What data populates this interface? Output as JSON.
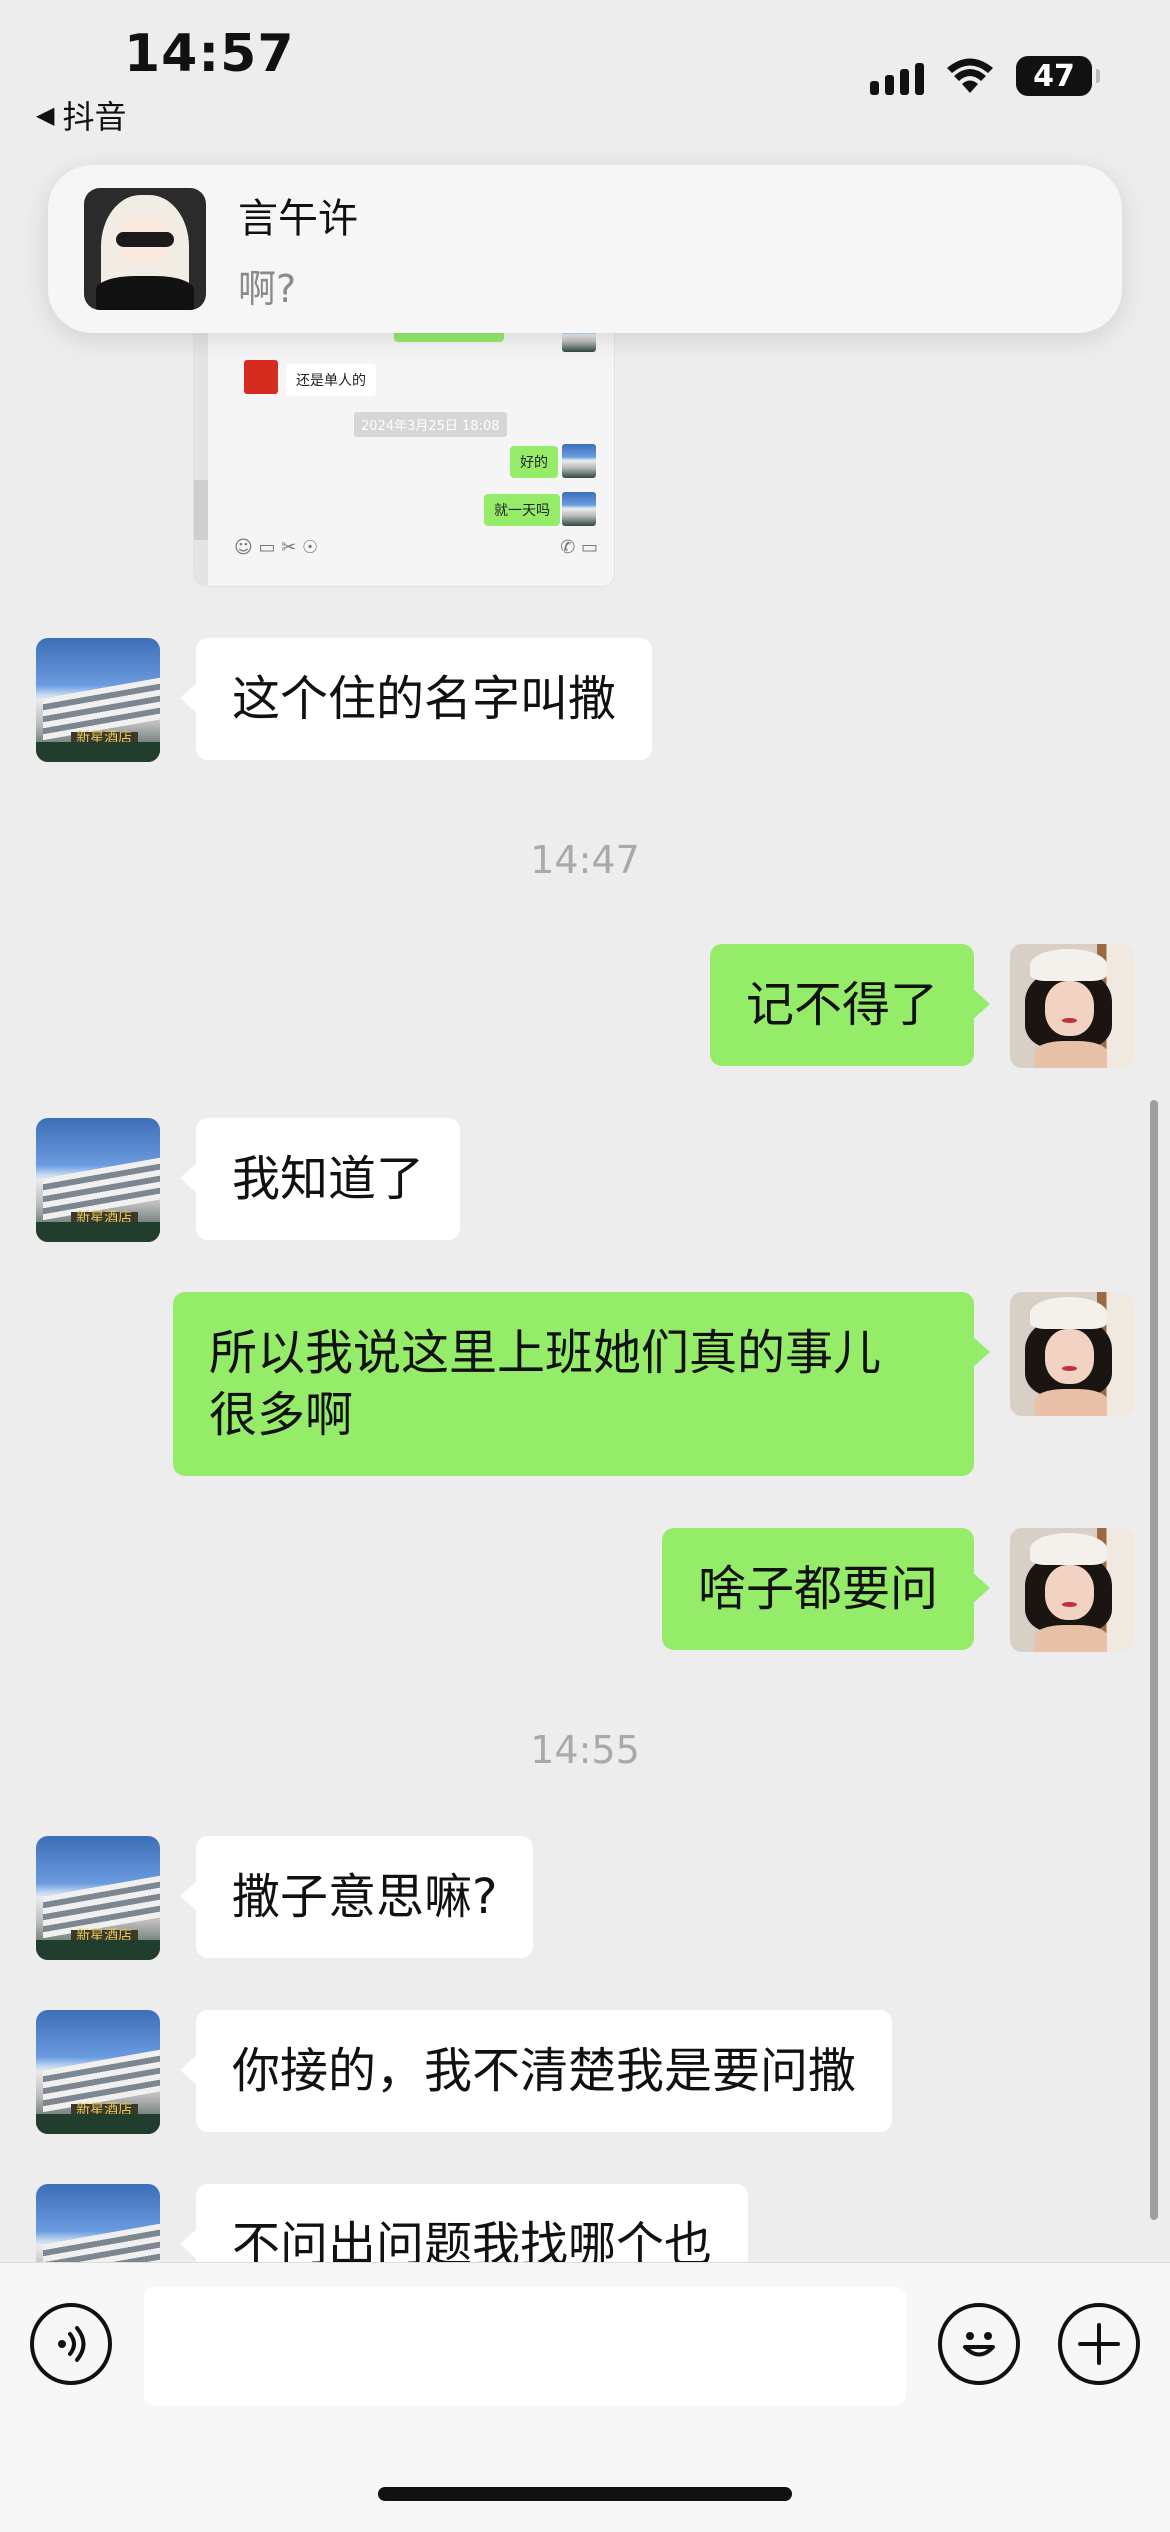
{
  "status_bar": {
    "time": "14:57",
    "back_app": "抖音",
    "battery": "47"
  },
  "notification": {
    "sender": "言午许",
    "message": "啊?"
  },
  "shared_screenshot": {
    "bubbles": [
      "还是单人的",
      "好的",
      "就一天吗"
    ],
    "timestamp": "2024年3月25日 18:08"
  },
  "messages": [
    {
      "side": "left",
      "text": "这个住的名字叫撒"
    },
    {
      "side": "time",
      "text": "14:47"
    },
    {
      "side": "right",
      "text": "记不得了"
    },
    {
      "side": "left",
      "text": "我知道了"
    },
    {
      "side": "right",
      "text": "所以我说这里上班她们真的事儿\n很多啊"
    },
    {
      "side": "right",
      "text": "啥子都要问"
    },
    {
      "side": "time",
      "text": "14:55"
    },
    {
      "side": "left",
      "text": "撒子意思嘛?"
    },
    {
      "side": "left",
      "text": "你接的，我不清楚我是要问撒"
    },
    {
      "side": "left",
      "text": "不问出问题我找哪个也"
    }
  ],
  "input": {
    "value": "",
    "placeholder": ""
  },
  "colors": {
    "background": "#ededed",
    "sent_bubble": "#95ec69",
    "received_bubble": "#ffffff"
  }
}
